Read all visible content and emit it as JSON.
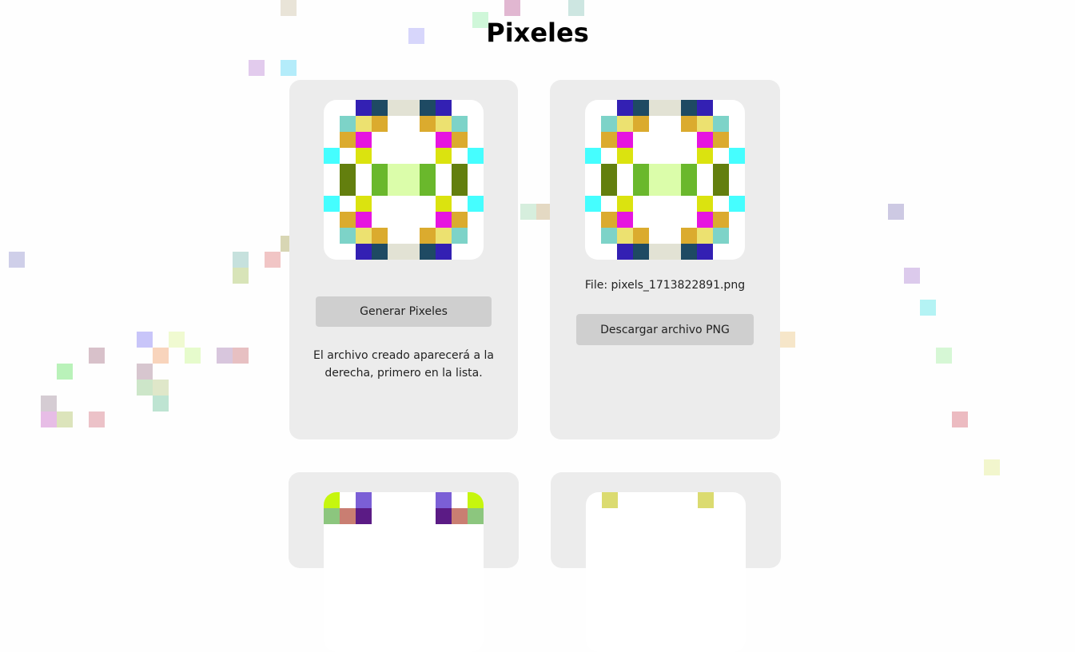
{
  "page": {
    "title": "Pixeles"
  },
  "generator": {
    "button_label": "Generar Pixeles",
    "hint": "El archivo creado aparecerá a la derecha, primero en la lista.",
    "pattern": "pattern_a"
  },
  "files": [
    {
      "filename": "File: pixels_1713822891.png",
      "download_label": "Descargar archivo PNG",
      "pattern": "pattern_a"
    }
  ],
  "patterns": {
    "pattern_a": {
      "size": 10,
      "palette": {
        "b": "#3320b3",
        "d": "#1e4a63",
        "g": "#e2e2d4",
        "t": "#7dd3c8",
        "y": "#ece170",
        "o": "#dbab2e",
        "m": "#e615e0",
        "c": "#45feff",
        "l": "#dbe30f",
        "v": "#637f0e",
        "e": "#6ab82c",
        "p": "#dbfdaa"
      },
      "rows": [
        "..bdggdb..",
        ".tyo..oyt.",
        ".om....mo.",
        "c.l....l.c",
        ".v.eppe.v.",
        ".v.eppe.v.",
        "c.l....l.c",
        ".om....mo.",
        ".tyo..oyt.",
        "..bdggdb.."
      ]
    },
    "pattern_b": {
      "size": 10,
      "palette": {
        "k": "#c6f60e",
        "u": "#7b5fd6",
        "g": "#8cc67e",
        "r": "#c97e72",
        "n": "#5b1b85"
      },
      "rows": [
        "k.u....u.k",
        "grn....nrg"
      ]
    },
    "pattern_c": {
      "size": 10,
      "palette": {
        "s": "#dbdb70"
      },
      "rows": [
        ".s.....s..",
        ".........."
      ]
    }
  },
  "partial_cards": [
    {
      "pattern": "pattern_b"
    },
    {
      "pattern": "pattern_c"
    }
  ],
  "background_squares": [
    {
      "color": "#e9e4d8"
    },
    {
      "color": "#e1b7d1"
    },
    {
      "color": "#cde6e1"
    },
    {
      "color": "#cff7d9"
    },
    {
      "color": "#d7d6fb"
    },
    {
      "color": "#e2cbed"
    },
    {
      "color": "#b4ecfa"
    },
    {
      "color": "#d8d6b4"
    },
    {
      "color": "#d6eedd"
    },
    {
      "color": "#e4d9c3"
    },
    {
      "color": "#cfcfe9"
    },
    {
      "color": "#c6e1dd"
    },
    {
      "color": "#f1c5c5"
    },
    {
      "color": "#d8e4b8"
    },
    {
      "color": "#d8c1ca"
    },
    {
      "color": "#cdc9e3"
    },
    {
      "color": "#dccaec"
    },
    {
      "color": "#b4f3f4"
    },
    {
      "color": "#c8c5f9"
    },
    {
      "color": "#f8d4bc"
    },
    {
      "color": "#e6fbcc"
    },
    {
      "color": "#d8c6dd"
    },
    {
      "color": "#e7c0c2"
    },
    {
      "color": "#d7c6cf"
    },
    {
      "color": "#b9f2b9"
    },
    {
      "color": "#d5ccd3"
    },
    {
      "color": "#cde6c9"
    },
    {
      "color": "#dfe7c9"
    },
    {
      "color": "#bee4d2"
    },
    {
      "color": "#e7bde6"
    },
    {
      "color": "#dce4bb"
    },
    {
      "color": "#ecc2c8"
    },
    {
      "color": "#f2f6cd"
    },
    {
      "color": "#f6e6c9"
    },
    {
      "color": "#d6f7d5"
    },
    {
      "color": "#ecbbc1"
    },
    {
      "color": "#f0fad1"
    }
  ]
}
